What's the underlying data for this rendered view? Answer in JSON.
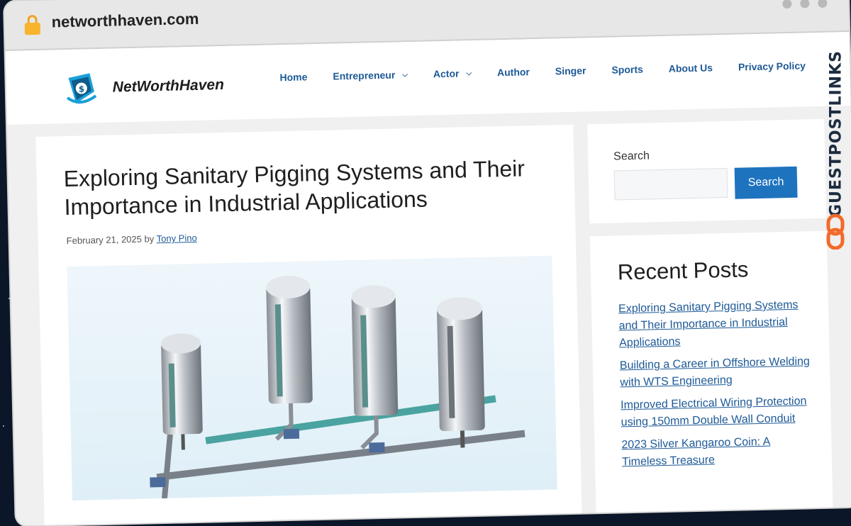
{
  "browser": {
    "url": "networthhaven.com"
  },
  "site": {
    "name": "NetWorthHaven",
    "nav": [
      {
        "label": "Home",
        "has_dropdown": false
      },
      {
        "label": "Entrepreneur",
        "has_dropdown": true
      },
      {
        "label": "Actor",
        "has_dropdown": true
      },
      {
        "label": "Author",
        "has_dropdown": false
      },
      {
        "label": "Singer",
        "has_dropdown": false
      },
      {
        "label": "Sports",
        "has_dropdown": false
      },
      {
        "label": "About Us",
        "has_dropdown": false
      },
      {
        "label": "Privacy Policy",
        "has_dropdown": false
      }
    ]
  },
  "post": {
    "title": "Exploring Sanitary Pigging Systems and Their Importance in Industrial Applications",
    "date": "February 21, 2025",
    "by": "by",
    "author": "Tony Pino"
  },
  "sidebar": {
    "search_label": "Search",
    "search_button": "Search",
    "recent_title": "Recent Posts",
    "recent_posts": [
      "Exploring Sanitary Pigging Systems and Their Importance in Industrial Applications",
      "Building a Career in Offshore Welding with WTS Engineering",
      "Improved Electrical Wiring Protection using 150mm Double Wall Conduit",
      "2023 Silver Kangaroo Coin: A Timeless Treasure"
    ]
  },
  "badge": {
    "text": "GUESTPOSTLINKS"
  },
  "colors": {
    "link": "#1e5a97",
    "button": "#1e73be",
    "badge_orange": "#f26b2a"
  }
}
